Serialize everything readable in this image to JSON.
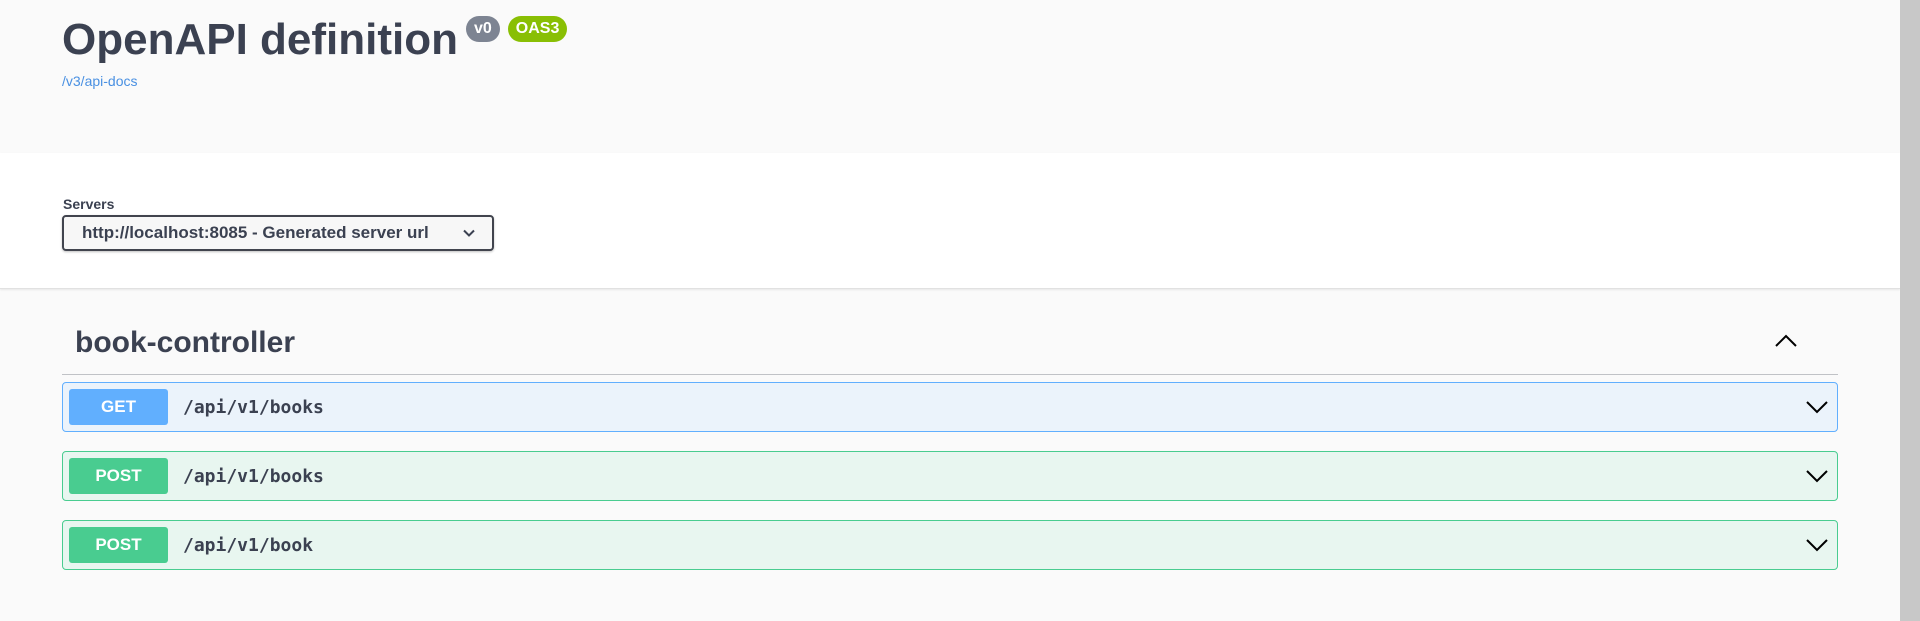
{
  "info": {
    "title": "OpenAPI definition",
    "version_badge": "v0",
    "spec_badge": "OAS3",
    "spec_link": "/v3/api-docs"
  },
  "servers": {
    "label": "Servers",
    "selected": "http://localhost:8085 - Generated server url"
  },
  "tag": {
    "name": "book-controller",
    "expanded": true
  },
  "operations": [
    {
      "method": "GET",
      "path": "/api/v1/books"
    },
    {
      "method": "POST",
      "path": "/api/v1/books"
    },
    {
      "method": "POST",
      "path": "/api/v1/book"
    }
  ],
  "colors": {
    "get": "#61affe",
    "post": "#49cc90",
    "oas_badge": "#89bf04",
    "version_badge": "#7d8492",
    "link": "#4990e2"
  }
}
